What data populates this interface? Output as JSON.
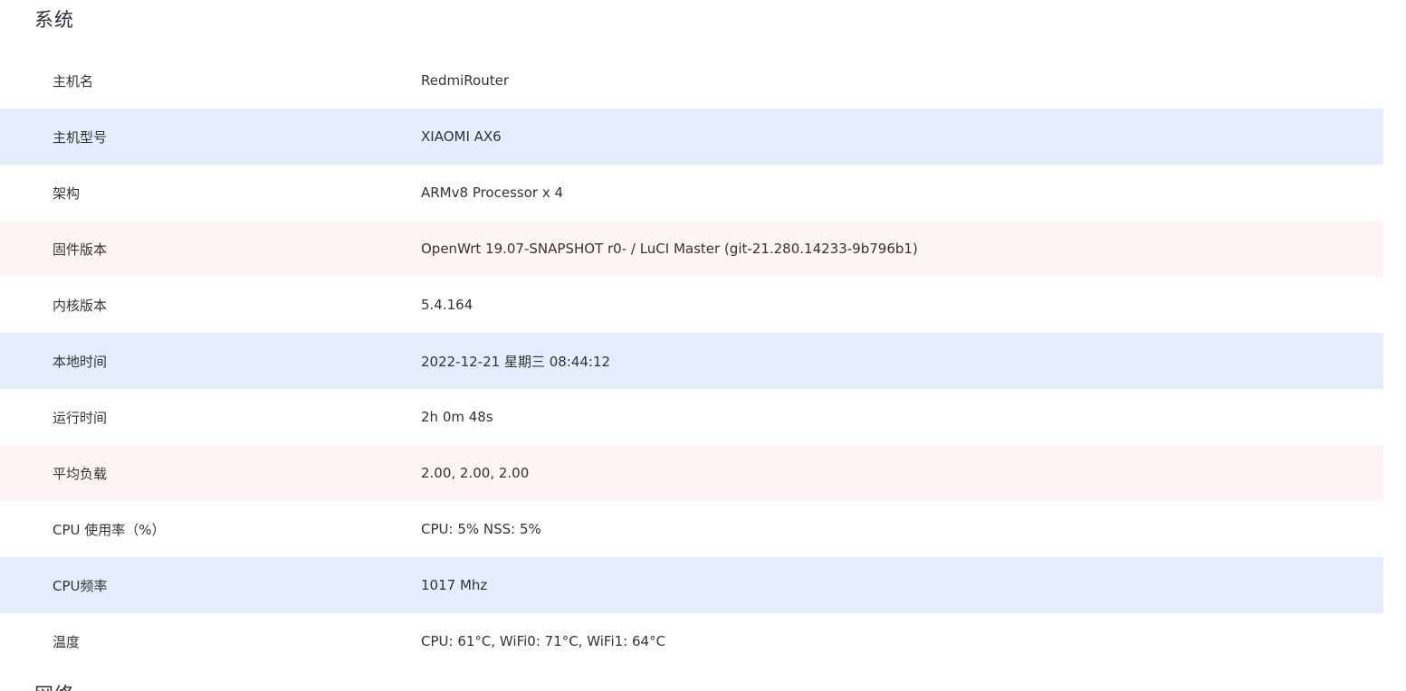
{
  "section": {
    "title": "系统",
    "next_title": "网络"
  },
  "colors": {
    "row_white": "#ffffff",
    "row_blue": "#e3edfc",
    "row_pink": "#fef4f3"
  },
  "rows": [
    {
      "label": "主机名",
      "value": "RedmiRouter",
      "bg": "white"
    },
    {
      "label": "主机型号",
      "value": "XIAOMI AX6",
      "bg": "blue"
    },
    {
      "label": "架构",
      "value": "ARMv8 Processor x 4",
      "bg": "white"
    },
    {
      "label": "固件版本",
      "value": "OpenWrt 19.07-SNAPSHOT r0- / LuCI Master (git-21.280.14233-9b796b1)",
      "bg": "pink"
    },
    {
      "label": "内核版本",
      "value": "5.4.164",
      "bg": "white"
    },
    {
      "label": "本地时间",
      "value": "2022-12-21 星期三 08:44:12",
      "bg": "blue"
    },
    {
      "label": "运行时间",
      "value": "2h 0m 48s",
      "bg": "white"
    },
    {
      "label": "平均负载",
      "value": "2.00, 2.00, 2.00",
      "bg": "pink"
    },
    {
      "label": "CPU 使用率（%）",
      "value": "CPU: 5% NSS: 5%",
      "bg": "white"
    },
    {
      "label": "CPU频率",
      "value": "1017 Mhz",
      "bg": "blue"
    },
    {
      "label": "温度",
      "value": "CPU: 61°C, WiFi0: 71°C, WiFi1: 64°C",
      "bg": "white"
    }
  ]
}
